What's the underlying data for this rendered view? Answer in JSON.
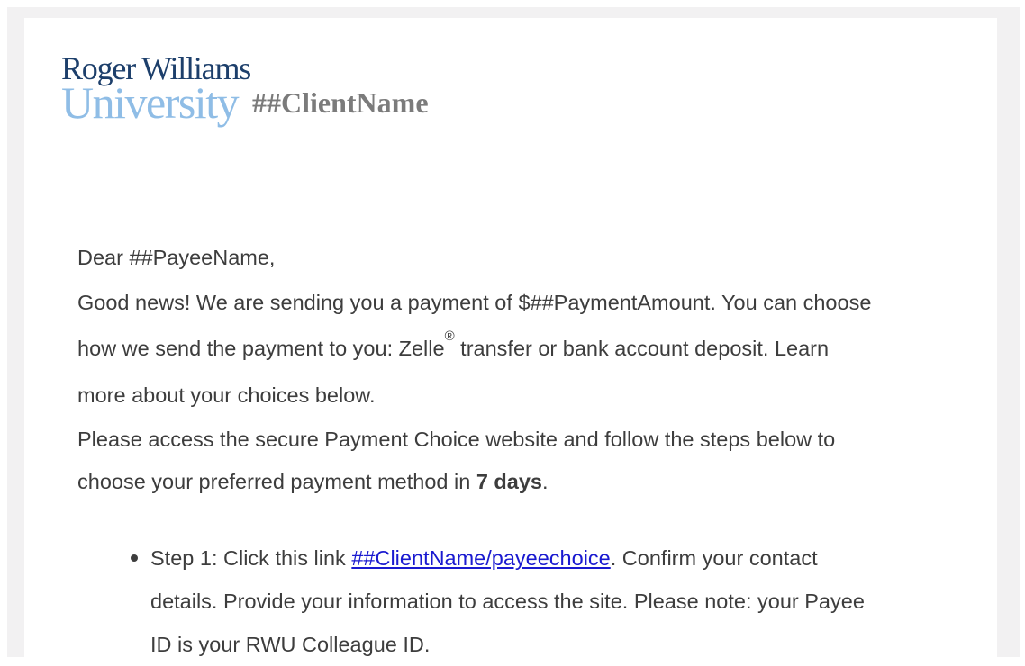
{
  "logo": {
    "line1": "Roger Williams",
    "line2": "University"
  },
  "header": {
    "client_name": "##ClientName"
  },
  "email": {
    "greeting": "Dear ##PayeeName,",
    "para1_line1": "Good news! We are sending you a payment of $##PaymentAmount. You can choose",
    "para1_line2_a": "how we send the payment to you: Zelle",
    "para1_line2_sup": "®",
    "para1_line2_b": " transfer or bank account deposit. Learn",
    "para1_line3": "more about your choices below.",
    "para2_line1": "Please access the secure Payment Choice website and follow the steps below to",
    "para2_line2_a": "choose your preferred payment method in ",
    "para2_line2_bold": "7 days",
    "para2_line2_b": "."
  },
  "steps": [
    {
      "prefix": "Step 1: Click this link ",
      "link": "##ClientName/payeechoice",
      "suffix_line1": ". Confirm your contact",
      "line2": "details. Provide your information to access the site. Please note: your Payee",
      "line3": "ID is your RWU Colleague ID."
    }
  ],
  "colors": {
    "logo_dark": "#1d3f6b",
    "logo_light": "#8fbde6",
    "link": "#1a1ad0",
    "body_text": "#3d3d3d",
    "outer_bg": "#f2f1f2"
  }
}
